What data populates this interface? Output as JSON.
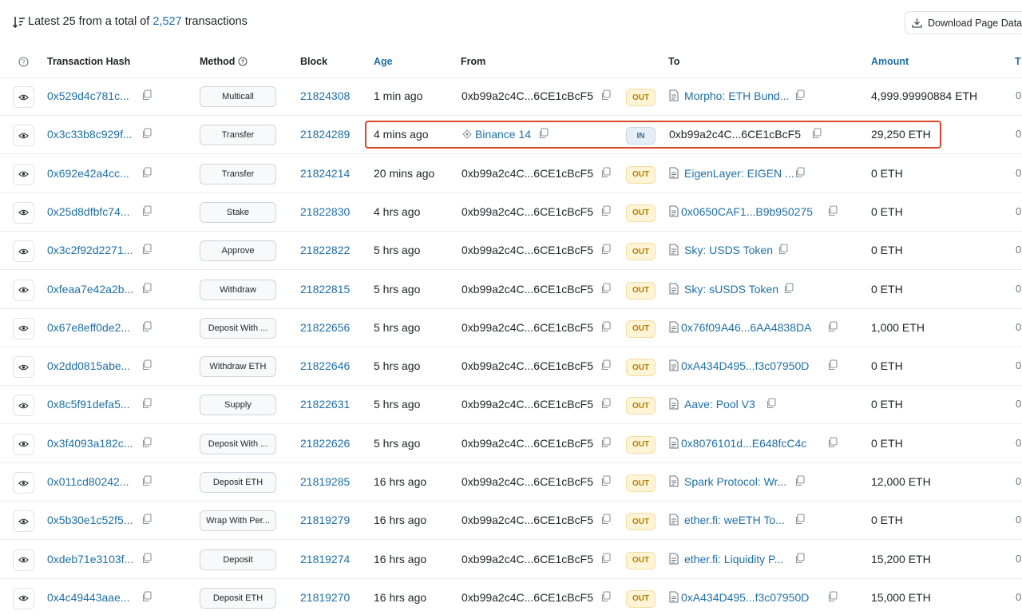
{
  "header": {
    "summary_prefix": "Latest 25 from a total of",
    "total_count": "2,527",
    "summary_suffix": "transactions",
    "download_label": "Download Page Data"
  },
  "columns": {
    "hash": "Transaction Hash",
    "method": "Method",
    "block": "Block",
    "age": "Age",
    "from": "From",
    "to": "To",
    "amount": "Amount",
    "tail": "T"
  },
  "rows": [
    {
      "hash": "0x529d4c781c...",
      "method": "Multicall",
      "block": "21824308",
      "age": "1 min ago",
      "from": "0xb99a2c4C...6CE1cBcF5",
      "from_is_link": false,
      "dir": "OUT",
      "to": "Morpho: ETH Bund...",
      "to_is_link": true,
      "to_contract": true,
      "amount": "4,999.99990884 ETH",
      "tail": "0"
    },
    {
      "hash": "0x3c33b8c929f...",
      "method": "Transfer",
      "block": "21824289",
      "age": "4 mins ago",
      "from": "Binance 14",
      "from_is_link": true,
      "dir": "IN",
      "to": "0xb99a2c4C...6CE1cBcF5",
      "to_is_link": false,
      "to_contract": false,
      "amount": "29,250 ETH",
      "tail": "0"
    },
    {
      "hash": "0x692e42a4cc...",
      "method": "Transfer",
      "block": "21824214",
      "age": "20 mins ago",
      "from": "0xb99a2c4C...6CE1cBcF5",
      "from_is_link": false,
      "dir": "OUT",
      "to": "EigenLayer: EIGEN ...",
      "to_is_link": true,
      "to_contract": true,
      "amount": "0 ETH",
      "tail": "0"
    },
    {
      "hash": "0x25d8dfbfc74...",
      "method": "Stake",
      "block": "21822830",
      "age": "4 hrs ago",
      "from": "0xb99a2c4C...6CE1cBcF5",
      "from_is_link": false,
      "dir": "OUT",
      "to": "0x0650CAF1...B9b950275",
      "to_is_link": true,
      "to_contract": true,
      "amount": "0 ETH",
      "tail": "0"
    },
    {
      "hash": "0x3c2f92d2271...",
      "method": "Approve",
      "block": "21822822",
      "age": "5 hrs ago",
      "from": "0xb99a2c4C...6CE1cBcF5",
      "from_is_link": false,
      "dir": "OUT",
      "to": "Sky: USDS Token",
      "to_is_link": true,
      "to_contract": true,
      "amount": "0 ETH",
      "tail": "0"
    },
    {
      "hash": "0xfeaa7e42a2b...",
      "method": "Withdraw",
      "block": "21822815",
      "age": "5 hrs ago",
      "from": "0xb99a2c4C...6CE1cBcF5",
      "from_is_link": false,
      "dir": "OUT",
      "to": "Sky: sUSDS Token",
      "to_is_link": true,
      "to_contract": true,
      "amount": "0 ETH",
      "tail": "0"
    },
    {
      "hash": "0x67e8eff0de2...",
      "method": "Deposit With ...",
      "block": "21822656",
      "age": "5 hrs ago",
      "from": "0xb99a2c4C...6CE1cBcF5",
      "from_is_link": false,
      "dir": "OUT",
      "to": "0x76f09A46...6AA4838DA",
      "to_is_link": true,
      "to_contract": true,
      "amount": "1,000 ETH",
      "tail": "0"
    },
    {
      "hash": "0x2dd0815abe...",
      "method": "Withdraw ETH",
      "block": "21822646",
      "age": "5 hrs ago",
      "from": "0xb99a2c4C...6CE1cBcF5",
      "from_is_link": false,
      "dir": "OUT",
      "to": "0xA434D495...f3c07950D",
      "to_is_link": true,
      "to_contract": true,
      "amount": "0 ETH",
      "tail": "0"
    },
    {
      "hash": "0x8c5f91defa5...",
      "method": "Supply",
      "block": "21822631",
      "age": "5 hrs ago",
      "from": "0xb99a2c4C...6CE1cBcF5",
      "from_is_link": false,
      "dir": "OUT",
      "to": "Aave: Pool V3",
      "to_is_link": true,
      "to_contract": true,
      "amount": "0 ETH",
      "tail": "0"
    },
    {
      "hash": "0x3f4093a182c...",
      "method": "Deposit With ...",
      "block": "21822626",
      "age": "5 hrs ago",
      "from": "0xb99a2c4C...6CE1cBcF5",
      "from_is_link": false,
      "dir": "OUT",
      "to": "0x8076101d...E648fcC4c",
      "to_is_link": true,
      "to_contract": true,
      "amount": "0 ETH",
      "tail": "0"
    },
    {
      "hash": "0x011cd80242...",
      "method": "Deposit ETH",
      "block": "21819285",
      "age": "16 hrs ago",
      "from": "0xb99a2c4C...6CE1cBcF5",
      "from_is_link": false,
      "dir": "OUT",
      "to": "Spark Protocol: Wr...",
      "to_is_link": true,
      "to_contract": true,
      "amount": "12,000 ETH",
      "tail": "0"
    },
    {
      "hash": "0x5b30e1c52f5...",
      "method": "Wrap With Per...",
      "block": "21819279",
      "age": "16 hrs ago",
      "from": "0xb99a2c4C...6CE1cBcF5",
      "from_is_link": false,
      "dir": "OUT",
      "to": "ether.fi: weETH To...",
      "to_is_link": true,
      "to_contract": true,
      "amount": "0 ETH",
      "tail": "0"
    },
    {
      "hash": "0xdeb71e3103f...",
      "method": "Deposit",
      "block": "21819274",
      "age": "16 hrs ago",
      "from": "0xb99a2c4C...6CE1cBcF5",
      "from_is_link": false,
      "dir": "OUT",
      "to": "ether.fi: Liquidity P...",
      "to_is_link": true,
      "to_contract": true,
      "amount": "15,200 ETH",
      "tail": "0"
    },
    {
      "hash": "0x4c49443aae...",
      "method": "Deposit ETH",
      "block": "21819270",
      "age": "16 hrs ago",
      "from": "0xb99a2c4C...6CE1cBcF5",
      "from_is_link": false,
      "dir": "OUT",
      "to": "0xA434D495...f3c07950D",
      "to_is_link": true,
      "to_contract": true,
      "amount": "15,000 ETH",
      "tail": "0"
    }
  ],
  "highlight_row": 1,
  "colors": {
    "link": "#1e6fa8",
    "highlight": "#d8452b",
    "out_badge": "#fff4d6",
    "in_badge": "#e6eef5"
  }
}
